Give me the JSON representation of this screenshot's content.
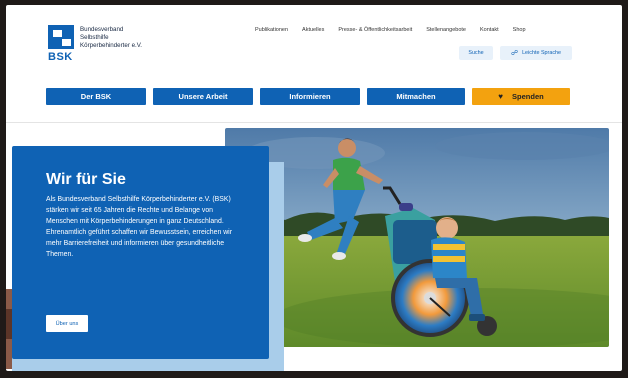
{
  "logo": {
    "abbr": "BSK",
    "line1": "Bundesverband",
    "line2": "Selbsthilfe",
    "line3": "Körperbehinderter e.V."
  },
  "top_nav": [
    "Publikationen",
    "Aktuelles",
    "Presse- & Öffentlichkeitsarbeit",
    "Stellenangebote",
    "Kontakt",
    "Shop"
  ],
  "utility": {
    "search_label": "Suche",
    "easy_language_label": "Leichte Sprache"
  },
  "main_nav": [
    "Der BSK",
    "Unsere Arbeit",
    "Informieren",
    "Mitmachen"
  ],
  "donate_label": "Spenden",
  "hero": {
    "title": "Wir für Sie",
    "body": "Als Bundesverband Selbsthilfe Körperbehinderter e.V. (BSK) stärken wir seit 65 Jahren die Rechte und Belange von Menschen mit Körperbehinderungen in ganz Deutschland. Ehrenamtlich geführt schaffen wir Bewusstsein, erreichen wir mehr Barrierefreiheit und informieren über gesundheitliche Themen.",
    "button_label": "Über uns"
  },
  "colors": {
    "brand_blue": "#0f62b4",
    "donate_orange": "#f3a20f",
    "box_shadow": "#a9cdea"
  }
}
